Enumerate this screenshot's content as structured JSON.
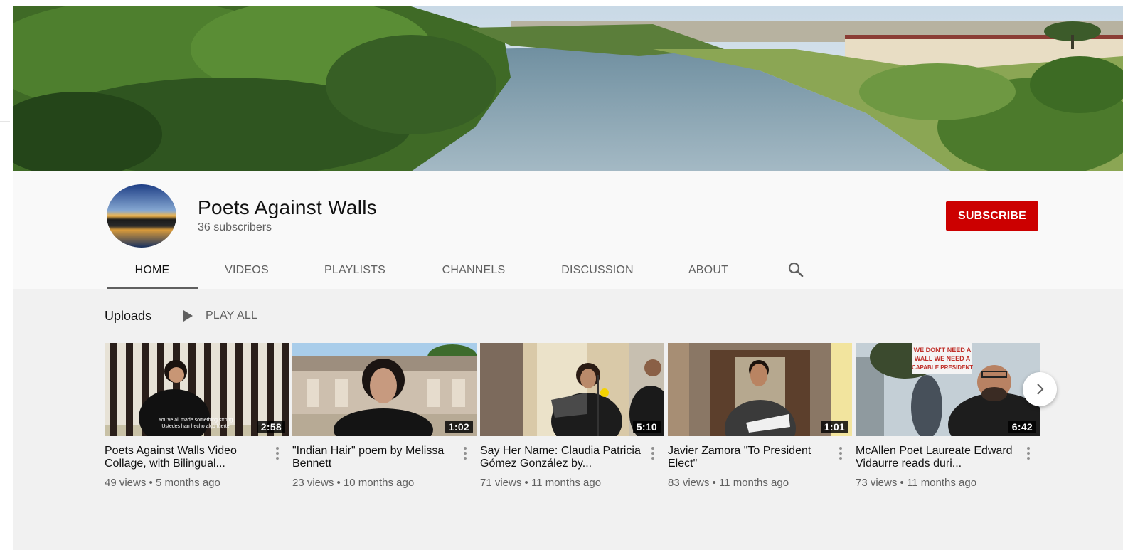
{
  "channel": {
    "title": "Poets Against Walls",
    "subscribers": "36 subscribers",
    "subscribe_label": "SUBSCRIBE"
  },
  "tabs": [
    {
      "label": "HOME",
      "active": true
    },
    {
      "label": "VIDEOS",
      "active": false
    },
    {
      "label": "PLAYLISTS",
      "active": false
    },
    {
      "label": "CHANNELS",
      "active": false
    },
    {
      "label": "DISCUSSION",
      "active": false
    },
    {
      "label": "ABOUT",
      "active": false
    }
  ],
  "icons": {
    "search": "search-icon",
    "play": "play-icon",
    "next": "chevron-right-icon",
    "more": "more-vert-icon"
  },
  "uploads": {
    "title": "Uploads",
    "play_all": "PLAY ALL",
    "videos": [
      {
        "title": "Poets Against Walls Video Collage, with Bilingual...",
        "duration": "2:58",
        "views": "49 views",
        "age": "5 months ago",
        "caption_line1": "You've all made something strong",
        "caption_line2": "Ustedes han hecho algo fuerte"
      },
      {
        "title": "\"Indian Hair\" poem by Melissa Bennett",
        "duration": "1:02",
        "views": "23 views",
        "age": "10 months ago"
      },
      {
        "title": "Say Her Name: Claudia Patricia Gómez González by...",
        "duration": "5:10",
        "views": "71 views",
        "age": "11 months ago"
      },
      {
        "title": "Javier Zamora \"To President Elect\"",
        "duration": "1:01",
        "views": "83 views",
        "age": "11 months ago"
      },
      {
        "title": "McAllen Poet Laureate Edward Vidaurre reads duri...",
        "duration": "6:42",
        "views": "73 views",
        "age": "11 months ago",
        "sign_line1": "WE DON'T NEED A",
        "sign_line2": "WALL WE NEED A",
        "sign_line3": "CAPABLE PRESIDENT"
      }
    ]
  },
  "colors": {
    "subscribe_bg": "#cc0000",
    "header_bg": "#f9f9f9",
    "content_bg": "#f1f1f1"
  }
}
